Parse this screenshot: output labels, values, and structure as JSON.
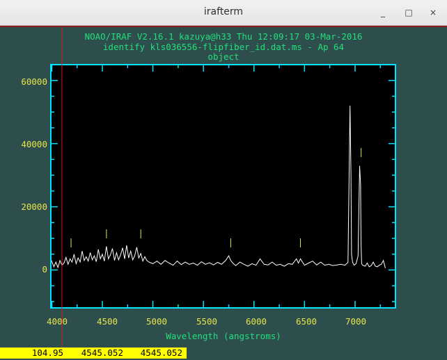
{
  "window": {
    "title": "irafterm",
    "controls": [
      "_",
      "□",
      "×"
    ]
  },
  "header": {
    "line1": "NOAO/IRAF V2.16.1 kazuya@h33 Thu 12:09:17 03-Mar-2016",
    "line2": "identify kls036556-flipfiber_id.dat.ms - Ap 64",
    "line3": "object"
  },
  "colors": {
    "background": "#2e4d4d",
    "plot_bg": "#000000",
    "frame": "#00e5ff",
    "spectrum": "#ffffff",
    "ticks_text": "#e6e64a",
    "header_text": "#22e07a",
    "cursor": "#cc2020",
    "status_bg": "#ffff00"
  },
  "chart_data": {
    "type": "line",
    "title": "",
    "xlabel": "Wavelength (angstroms)",
    "ylabel": "",
    "xlim": [
      3990,
      7400
    ],
    "ylim": [
      -12000,
      65000
    ],
    "x_ticks": [
      4000,
      4500,
      5000,
      5500,
      6000,
      6500,
      7000
    ],
    "y_ticks": [
      0,
      20000,
      40000,
      60000
    ],
    "grid": false,
    "series": [
      {
        "x": [
          3990,
          4020,
          4040,
          4060,
          4080,
          4100,
          4120,
          4140,
          4160,
          4180,
          4200,
          4220,
          4240,
          4260,
          4280,
          4300,
          4320,
          4340,
          4360,
          4380,
          4400,
          4420,
          4440,
          4460,
          4480,
          4500,
          4520,
          4540,
          4560,
          4580,
          4600,
          4620,
          4640,
          4660,
          4680,
          4700,
          4720,
          4740,
          4760,
          4780,
          4800,
          4820,
          4840,
          4860,
          4880,
          4900,
          4920,
          4940,
          4960,
          5000,
          5040,
          5080,
          5120,
          5160,
          5200,
          5240,
          5280,
          5320,
          5360,
          5400,
          5440,
          5480,
          5520,
          5560,
          5600,
          5640,
          5680,
          5720,
          5750,
          5770,
          5790,
          5820,
          5860,
          5900,
          5940,
          5980,
          6020,
          6060,
          6100,
          6140,
          6180,
          6220,
          6260,
          6300,
          6340,
          6380,
          6420,
          6440,
          6460,
          6500,
          6540,
          6580,
          6620,
          6660,
          6700,
          6740,
          6780,
          6820,
          6860,
          6900,
          6930,
          6950,
          6960,
          6965,
          6975,
          6990,
          7010,
          7030,
          7045,
          7055,
          7060,
          7065,
          7075,
          7100,
          7120,
          7140,
          7160,
          7180,
          7200,
          7220,
          7240,
          7260,
          7280,
          7300
        ],
        "y": [
          3500,
          1000,
          2500,
          800,
          3000,
          1500,
          2200,
          4000,
          1800,
          3500,
          2500,
          5000,
          2000,
          3800,
          2500,
          6000,
          3000,
          4200,
          2800,
          5500,
          3200,
          4500,
          2600,
          6500,
          3500,
          5000,
          2800,
          7500,
          3500,
          4800,
          6800,
          3000,
          5500,
          3200,
          4800,
          7000,
          3500,
          7800,
          3800,
          6000,
          3200,
          4500,
          7200,
          3800,
          5200,
          2800,
          4200,
          3000,
          2500,
          2000,
          2800,
          1800,
          3000,
          2200,
          1500,
          2800,
          1700,
          2500,
          1800,
          2200,
          1500,
          2600,
          1800,
          2300,
          1600,
          2400,
          1800,
          3000,
          4500,
          3000,
          2200,
          1400,
          2500,
          1800,
          1200,
          2000,
          1500,
          3500,
          1800,
          1600,
          2500,
          1500,
          1800,
          1200,
          2000,
          1800,
          3500,
          2200,
          3500,
          1500,
          2200,
          2800,
          1600,
          2500,
          1500,
          1800,
          1400,
          1600,
          1800,
          1500,
          2400,
          52000,
          30000,
          5000,
          2500,
          1500,
          2000,
          4500,
          33000,
          27000,
          8000,
          2000,
          1500,
          1200,
          2200,
          1000,
          1400,
          2500,
          1200,
          1000,
          1500,
          1800,
          3000,
          600
        ]
      }
    ],
    "line_markers_x": [
      4190,
      4540,
      4880,
      5770,
      6460,
      7060
    ]
  },
  "cursor": {
    "x": 4100
  },
  "status": {
    "value1": "104.95",
    "value2": "4545.052",
    "value3": "4545.052"
  }
}
